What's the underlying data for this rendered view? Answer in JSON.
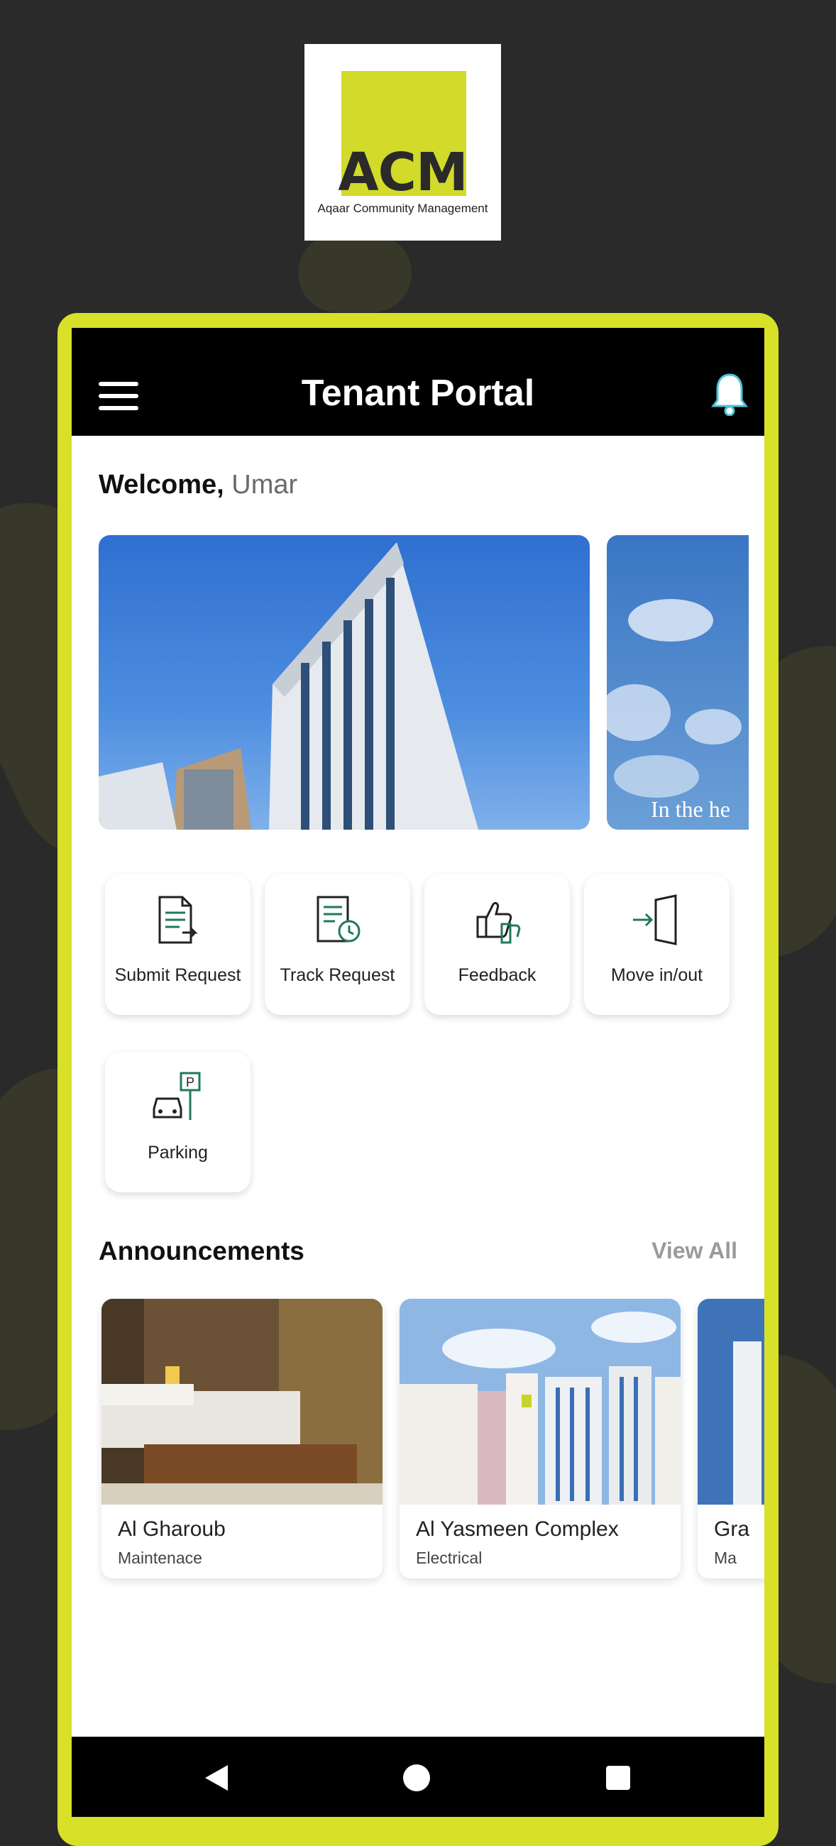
{
  "logo": {
    "mark": "ACM",
    "tagline": "Aqaar Community Management"
  },
  "header": {
    "title": "Tenant Portal",
    "menu_icon": "hamburger-icon",
    "notification_icon": "bell-icon"
  },
  "welcome": {
    "greeting": "Welcome,",
    "name": "Umar"
  },
  "banners": [
    {
      "caption": ""
    },
    {
      "caption": "In the he"
    }
  ],
  "actions": [
    {
      "label": "Submit Request",
      "icon": "submit-request-icon"
    },
    {
      "label": "Track Request",
      "icon": "track-request-icon"
    },
    {
      "label": "Feedback",
      "icon": "feedback-icon"
    },
    {
      "label": "Move in/out",
      "icon": "move-in-out-icon"
    },
    {
      "label": "Parking",
      "icon": "parking-icon"
    }
  ],
  "announcements": {
    "title": "Announcements",
    "view_all": "View All",
    "items": [
      {
        "title": "Al Gharoub",
        "category": "Maintenace"
      },
      {
        "title": "Al Yasmeen Complex",
        "category": "Electrical"
      },
      {
        "title": "Gra",
        "category": "Ma"
      }
    ]
  },
  "colors": {
    "accent": "#d8e027",
    "appbar": "#000000",
    "icon_green": "#1e7a5a"
  }
}
